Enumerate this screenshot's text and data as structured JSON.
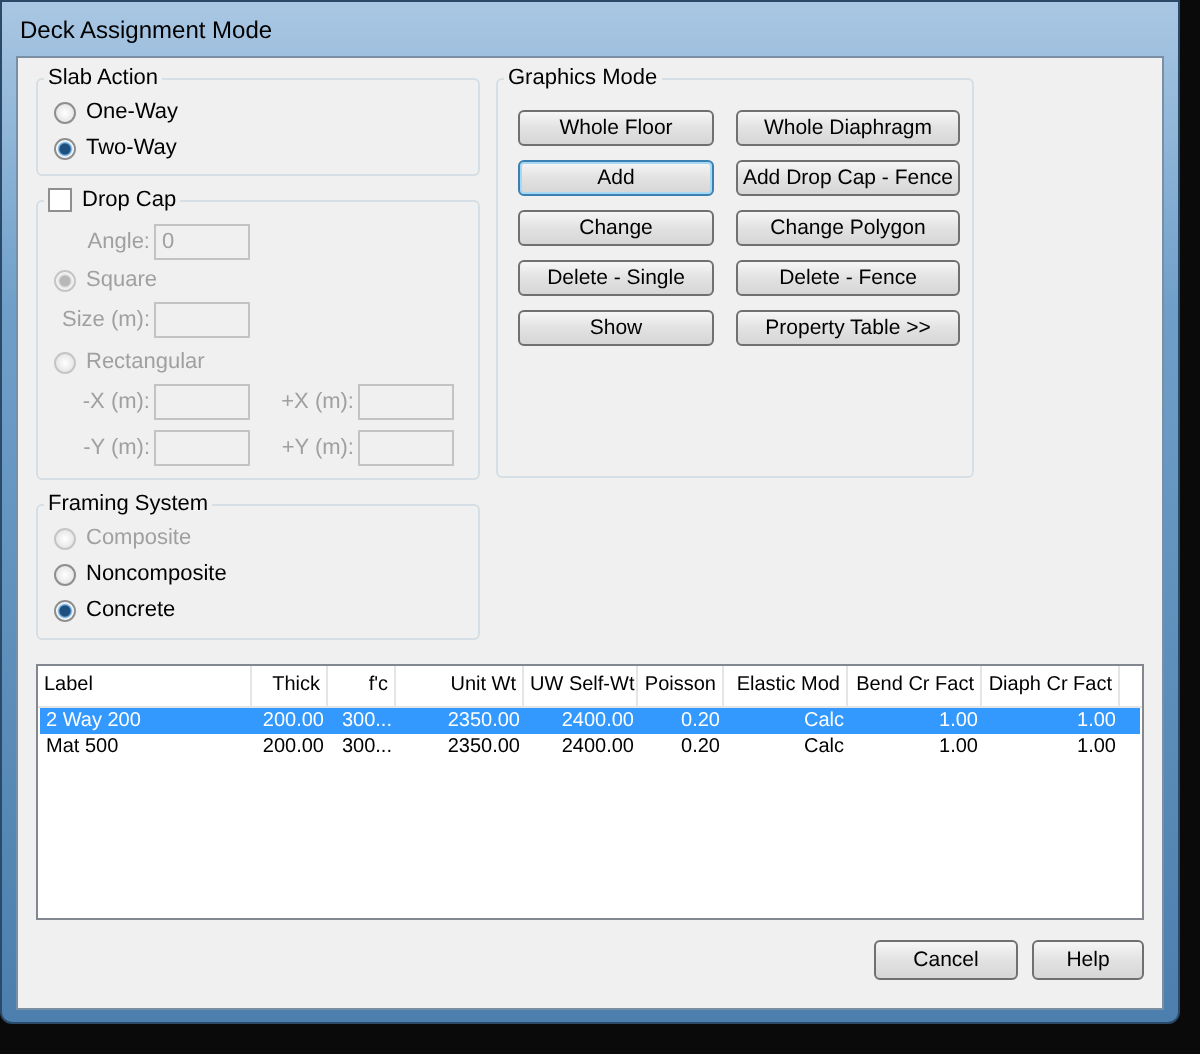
{
  "window": {
    "title": "Deck Assignment Mode"
  },
  "slab_action": {
    "title": "Slab Action",
    "options": [
      {
        "label": "One-Way",
        "selected": false,
        "disabled": false
      },
      {
        "label": "Two-Way",
        "selected": true,
        "disabled": false
      }
    ]
  },
  "drop_cap": {
    "label": "Drop Cap",
    "checked": false,
    "angle": {
      "label": "Angle:",
      "value": "0"
    },
    "shapes": [
      {
        "label": "Square",
        "selected": true,
        "disabled": true,
        "fields": [
          {
            "label": "Size (m):"
          }
        ]
      },
      {
        "label": "Rectangular",
        "selected": false,
        "disabled": true,
        "fields": [
          {
            "label": "-X (m):"
          },
          {
            "label": "+X (m):"
          },
          {
            "label": "-Y (m):"
          },
          {
            "label": "+Y (m):"
          }
        ]
      }
    ]
  },
  "framing_system": {
    "title": "Framing System",
    "options": [
      {
        "label": "Composite",
        "selected": false,
        "disabled": true
      },
      {
        "label": "Noncomposite",
        "selected": false,
        "disabled": false
      },
      {
        "label": "Concrete",
        "selected": true,
        "disabled": false
      }
    ]
  },
  "graphics_mode": {
    "title": "Graphics Mode",
    "buttons": [
      {
        "label": "Whole Floor",
        "focused": false
      },
      {
        "label": "Whole Diaphragm",
        "focused": false
      },
      {
        "label": "Add",
        "focused": true
      },
      {
        "label": "Add Drop Cap - Fence",
        "focused": false
      },
      {
        "label": "Change",
        "focused": false
      },
      {
        "label": "Change Polygon",
        "focused": false
      },
      {
        "label": "Delete - Single",
        "focused": false
      },
      {
        "label": "Delete - Fence",
        "focused": false
      },
      {
        "label": "Show",
        "focused": false
      },
      {
        "label": "Property Table >>",
        "focused": false
      }
    ]
  },
  "table": {
    "columns": [
      "Label",
      "Thick",
      "f'c",
      "Unit Wt",
      "UW Self-Wt",
      "Poisson",
      "Elastic Mod",
      "Bend Cr Fact",
      "Diaph Cr Fact"
    ],
    "rows": [
      {
        "selected": true,
        "cells": [
          "2 Way 200",
          "200.00",
          "300...",
          "2350.00",
          "2400.00",
          "0.20",
          "Calc",
          "1.00",
          "1.00"
        ]
      },
      {
        "selected": false,
        "cells": [
          "Mat 500",
          "200.00",
          "300...",
          "2350.00",
          "2400.00",
          "0.20",
          "Calc",
          "1.00",
          "1.00"
        ]
      }
    ]
  },
  "buttons": [
    "Cancel",
    "Help"
  ]
}
